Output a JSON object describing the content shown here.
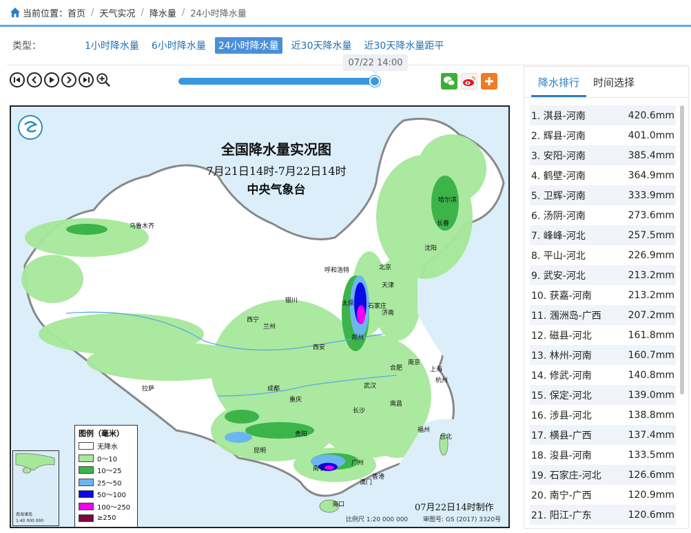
{
  "breadcrumb": {
    "label": "当前位置：",
    "items": [
      "首页",
      "天气实况",
      "降水量",
      "24小时降水量"
    ]
  },
  "type_filter": {
    "label": "类型：",
    "tabs": [
      "1小时降水量",
      "6小时降水量",
      "24小时降水量",
      "近30天降水量",
      "近30天降水量距平"
    ],
    "active_index": 2
  },
  "player": {
    "time_tooltip": "07/22 14:00",
    "progress_fraction": 0.99,
    "buttons": [
      "first-icon",
      "prev-icon",
      "play-icon",
      "next-icon",
      "last-icon",
      "zoom-in-icon"
    ]
  },
  "share": {
    "icons": [
      "wechat-icon",
      "weibo-icon",
      "plus-icon"
    ],
    "colors": {
      "wechat": "#3cb034",
      "weibo": "#e6162d",
      "plus": "#f07b22"
    }
  },
  "map": {
    "title": "全国降水量实况图",
    "subtitle": "7月21日14时-7月22日14时",
    "org": "中央气象台",
    "made": "07月22日14时制作",
    "scale": "比例尺 1:20 000 000",
    "review_no": "审图号: GS (2017) 3320号",
    "inset_label": "南海诸岛",
    "inset_scale": "1:40 000 000",
    "legend": {
      "title": "图例（毫米）",
      "items": [
        {
          "label": "无降水",
          "color": "#ffffff"
        },
        {
          "label": "0～10",
          "color": "#a6e89a"
        },
        {
          "label": "10～25",
          "color": "#3cb44a"
        },
        {
          "label": "25～50",
          "color": "#6cb6f0"
        },
        {
          "label": "50～100",
          "color": "#0a0ae6"
        },
        {
          "label": "100～250",
          "color": "#f000f0"
        },
        {
          "label": "≥250",
          "color": "#7a0a3c"
        }
      ]
    },
    "cities": [
      "乌鲁木齐",
      "哈尔滨",
      "长春",
      "沈阳",
      "呼和浩特",
      "北京",
      "天津",
      "银川",
      "太原",
      "石家庄",
      "济南",
      "西宁",
      "兰州",
      "郑州",
      "西安",
      "南京",
      "合肥",
      "上海",
      "拉萨",
      "成都",
      "武汉",
      "杭州",
      "重庆",
      "长沙",
      "南昌",
      "贵阳",
      "福州",
      "台北",
      "昆明",
      "南宁",
      "广州",
      "香港",
      "澳门",
      "海口"
    ]
  },
  "sidebar": {
    "tabs": [
      "降水排行",
      "时间选择"
    ],
    "active_index": 0,
    "ranking": [
      {
        "rank": "1.",
        "name": "淇县-河南",
        "value": "420.6mm"
      },
      {
        "rank": "2.",
        "name": "辉县-河南",
        "value": "401.0mm"
      },
      {
        "rank": "3.",
        "name": "安阳-河南",
        "value": "385.4mm"
      },
      {
        "rank": "4.",
        "name": "鹤壁-河南",
        "value": "364.9mm"
      },
      {
        "rank": "5.",
        "name": "卫辉-河南",
        "value": "333.9mm"
      },
      {
        "rank": "6.",
        "name": "汤阴-河南",
        "value": "273.6mm"
      },
      {
        "rank": "7.",
        "name": "峰峰-河北",
        "value": "257.5mm"
      },
      {
        "rank": "8.",
        "name": "平山-河北",
        "value": "226.9mm"
      },
      {
        "rank": "9.",
        "name": "武安-河北",
        "value": "213.2mm"
      },
      {
        "rank": "10.",
        "name": "获嘉-河南",
        "value": "213.2mm"
      },
      {
        "rank": "11.",
        "name": "涠洲岛-广西",
        "value": "207.2mm"
      },
      {
        "rank": "12.",
        "name": "磁县-河北",
        "value": "161.8mm"
      },
      {
        "rank": "13.",
        "name": "林州-河南",
        "value": "160.7mm"
      },
      {
        "rank": "14.",
        "name": "修武-河南",
        "value": "140.8mm"
      },
      {
        "rank": "15.",
        "name": "保定-河北",
        "value": "139.0mm"
      },
      {
        "rank": "16.",
        "name": "涉县-河北",
        "value": "138.8mm"
      },
      {
        "rank": "17.",
        "name": "横县-广西",
        "value": "137.4mm"
      },
      {
        "rank": "18.",
        "name": "浚县-河南",
        "value": "133.5mm"
      },
      {
        "rank": "19.",
        "name": "石家庄-河北",
        "value": "126.6mm"
      },
      {
        "rank": "20.",
        "name": "南宁-广西",
        "value": "120.9mm"
      },
      {
        "rank": "21.",
        "name": "阳江-广东",
        "value": "120.6mm"
      }
    ]
  }
}
